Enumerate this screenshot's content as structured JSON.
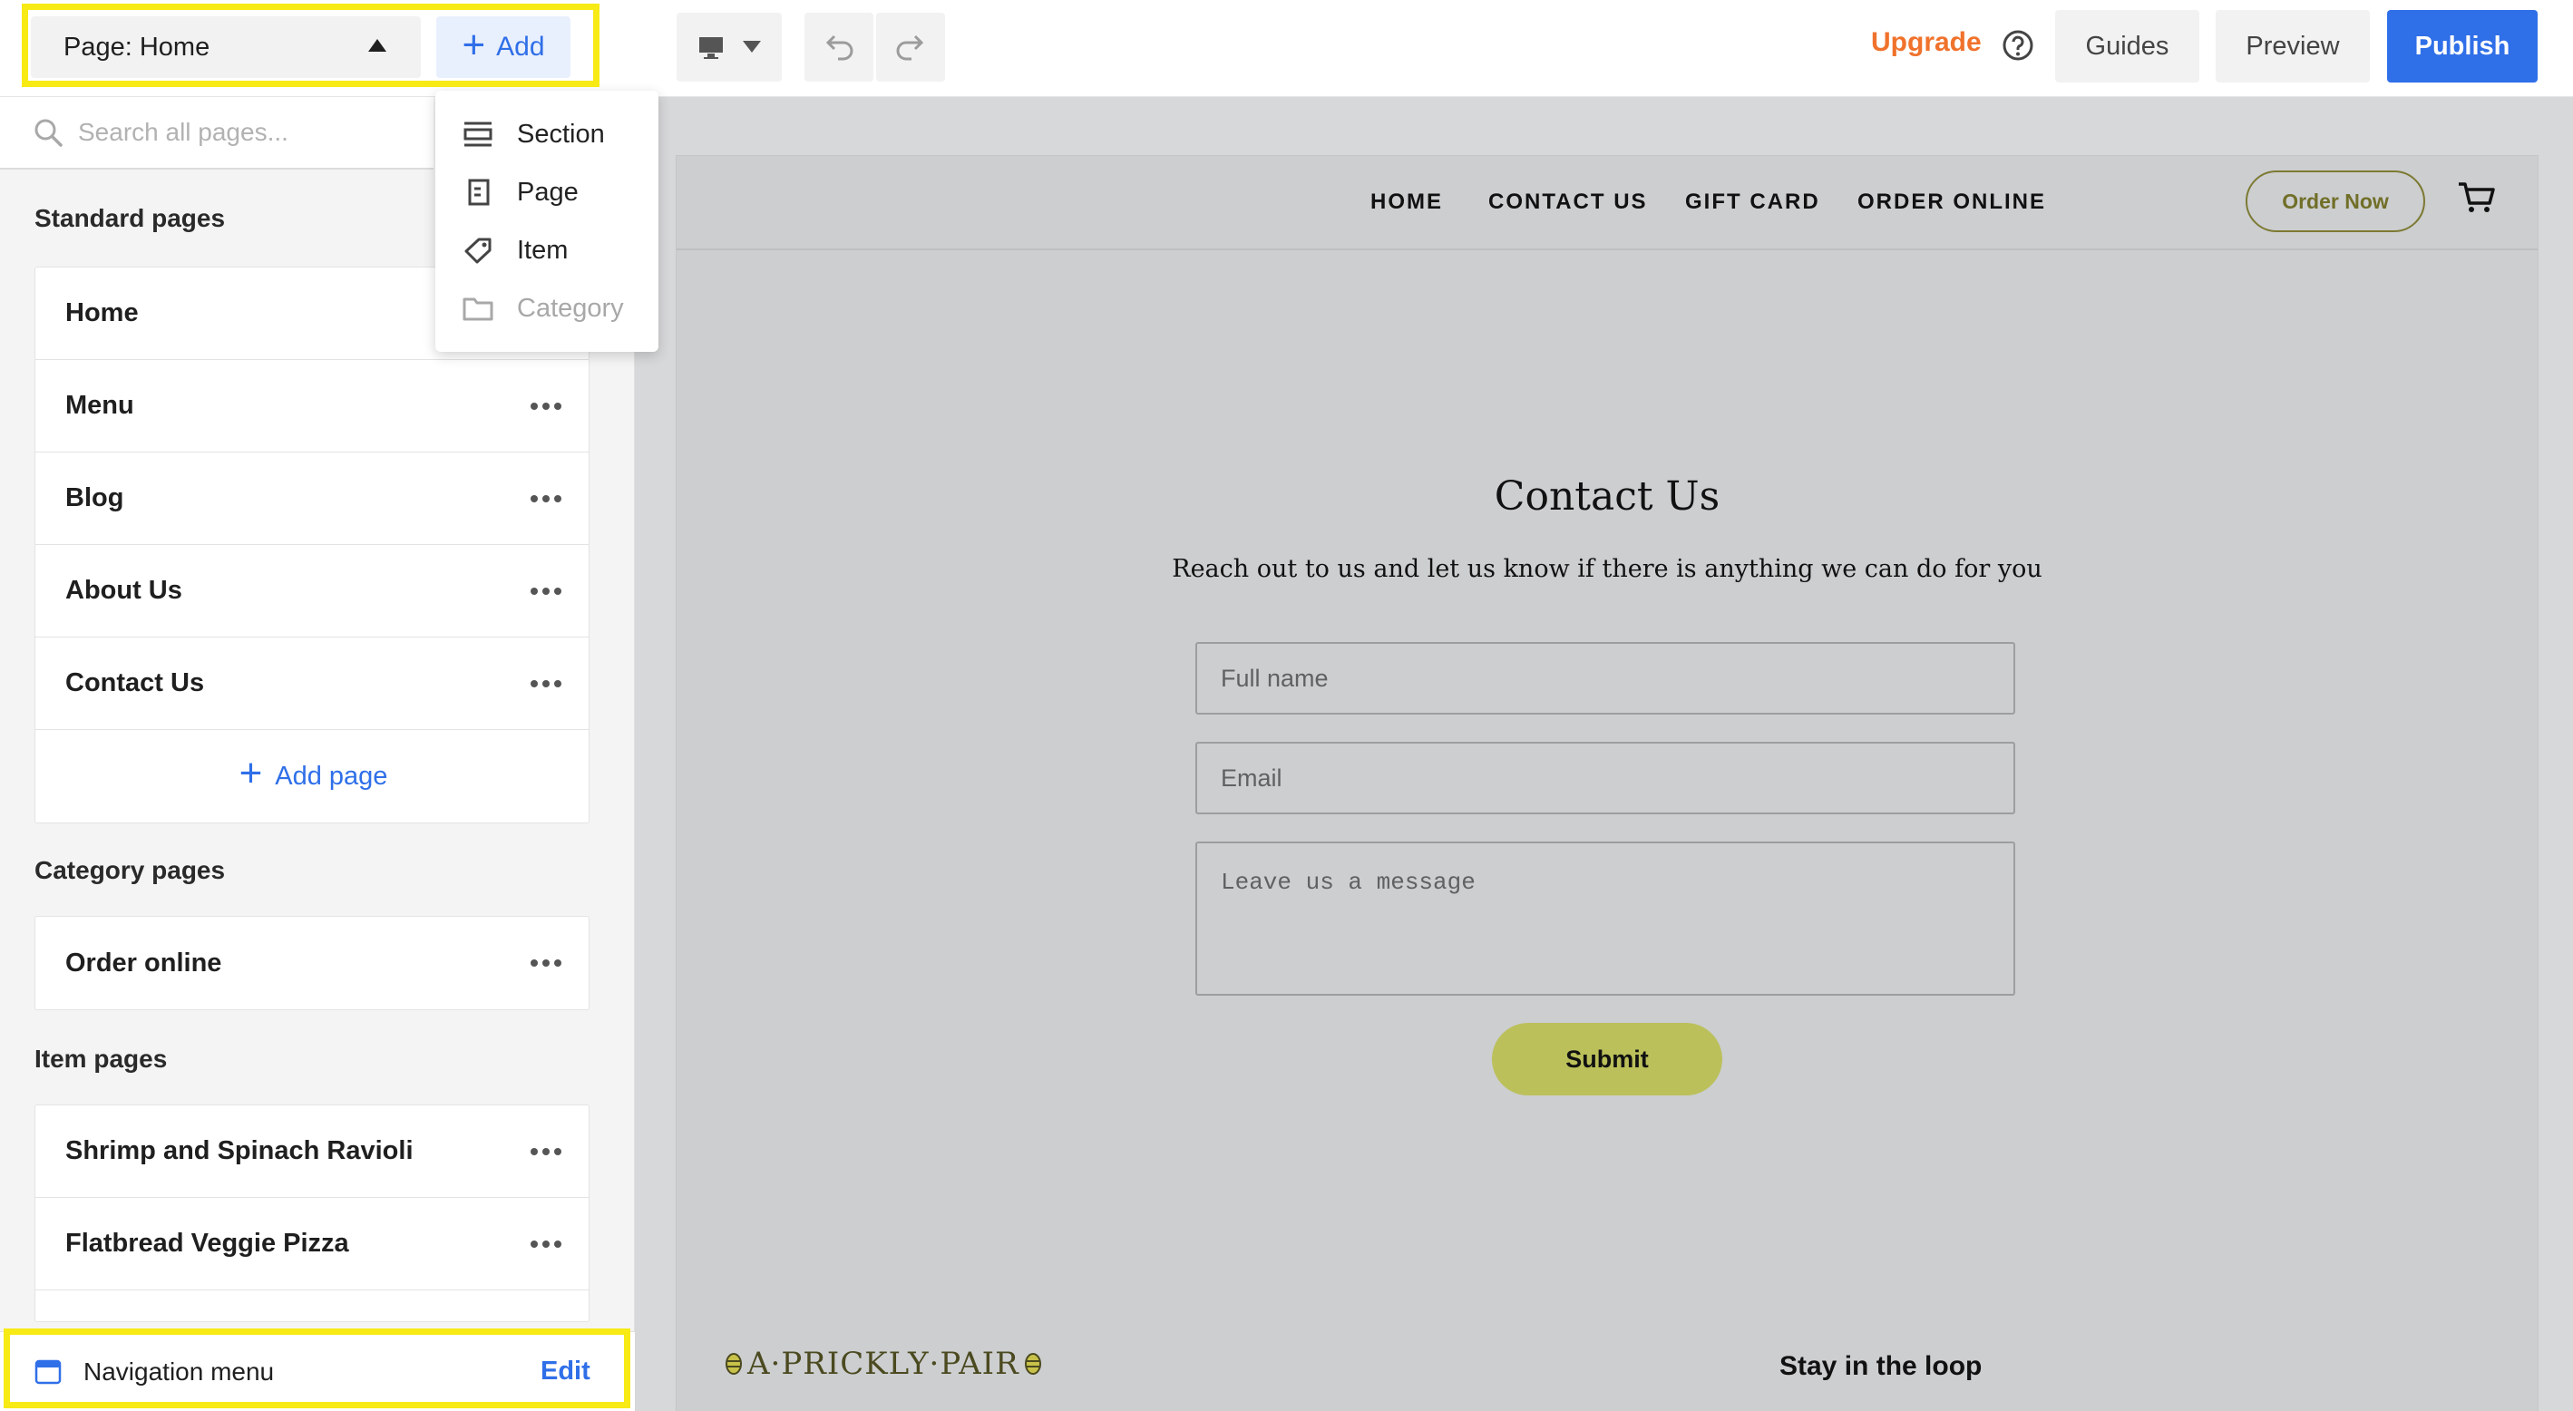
{
  "toolbar": {
    "page_select_label": "Page: Home",
    "add_label": "Add",
    "upgrade_label": "Upgrade",
    "guides_label": "Guides",
    "preview_label": "Preview",
    "publish_label": "Publish"
  },
  "add_menu": {
    "items": [
      {
        "label": "Section",
        "icon": "section-icon",
        "enabled": true
      },
      {
        "label": "Page",
        "icon": "page-icon",
        "enabled": true
      },
      {
        "label": "Item",
        "icon": "tag-icon",
        "enabled": true
      },
      {
        "label": "Category",
        "icon": "folder-icon",
        "enabled": false
      }
    ]
  },
  "sidebar": {
    "search_placeholder": "Search all pages...",
    "standard_title": "Standard pages",
    "standard_pages": [
      "Home",
      "Menu",
      "Blog",
      "About Us",
      "Contact Us"
    ],
    "add_page_label": "Add page",
    "category_title": "Category pages",
    "category_pages": [
      "Order online"
    ],
    "item_title": "Item pages",
    "item_pages": [
      "Shrimp and Spinach Ravioli",
      "Flatbread Veggie Pizza"
    ],
    "nav_menu_label": "Navigation menu",
    "nav_menu_edit": "Edit"
  },
  "site": {
    "nav": [
      "HOME",
      "CONTACT US",
      "GIFT CARD",
      "ORDER ONLINE"
    ],
    "order_now": "Order Now",
    "contact_title": "Contact Us",
    "contact_subtitle": "Reach out to us and let us know if there is anything we can do for you",
    "full_name_placeholder": "Full name",
    "email_placeholder": "Email",
    "message_placeholder": "Leave us a message",
    "submit_label": "Submit",
    "logo_text": "A·PRICKLY·PAIR",
    "footer_heading": "Stay in the loop"
  },
  "colors": {
    "accent": "#2f6fe8",
    "upgrade": "#f0722c",
    "highlight": "#f7ea15",
    "submit": "#bbc05a"
  }
}
